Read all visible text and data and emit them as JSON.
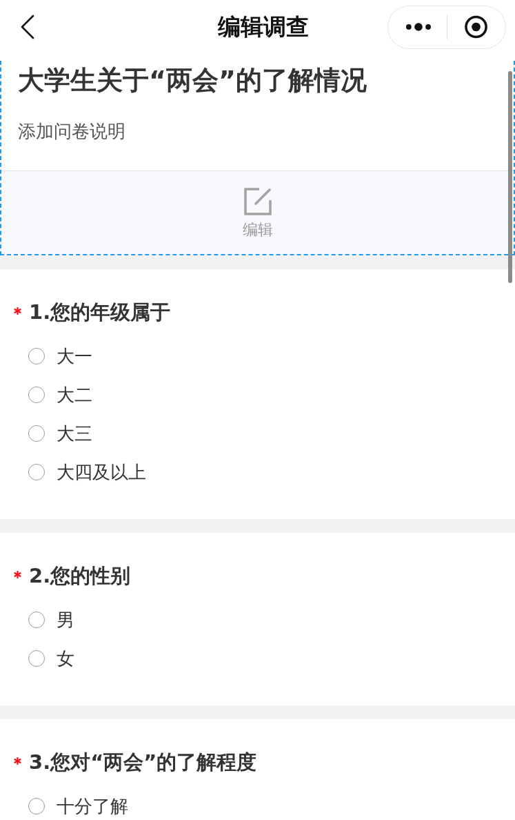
{
  "nav": {
    "title": "编辑调查"
  },
  "header": {
    "title": "大学生关于“两会”的了解情况",
    "description": "添加问卷说明",
    "edit_label": "编辑",
    "selected": true
  },
  "questions": [
    {
      "title": "1.您的年级属于",
      "required": true,
      "selected": false,
      "options": [
        {
          "label": "大一",
          "selected": false
        },
        {
          "label": "大二",
          "selected": false
        },
        {
          "label": "大三",
          "selected": false
        },
        {
          "label": "大四及以上",
          "selected": false
        }
      ]
    },
    {
      "title": "2.您的性别",
      "required": true,
      "selected": false,
      "options": [
        {
          "label": "男",
          "selected": false
        },
        {
          "label": "女",
          "selected": false
        }
      ]
    },
    {
      "title": "3.您对“两会”的了解程度",
      "required": true,
      "selected": false,
      "options": [
        {
          "label": "十分了解",
          "selected": false
        }
      ]
    }
  ]
}
